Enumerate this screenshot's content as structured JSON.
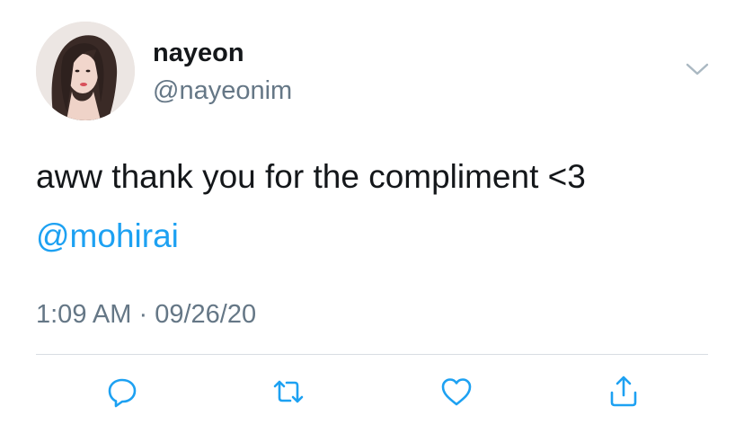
{
  "user": {
    "display_name": "nayeon",
    "handle": "@nayeonim"
  },
  "tweet": {
    "text": "aww thank you for the compliment <3",
    "mention": "@mohirai",
    "time": "1:09 AM",
    "separator": "·",
    "date": "09/26/20"
  },
  "icons": {
    "menu": "chevron-down-icon",
    "reply": "reply-icon",
    "retweet": "retweet-icon",
    "like": "heart-icon",
    "share": "share-icon"
  },
  "colors": {
    "text": "#14171a",
    "secondary": "#657786",
    "link": "#1da1f2",
    "divider": "#d8dde2"
  }
}
